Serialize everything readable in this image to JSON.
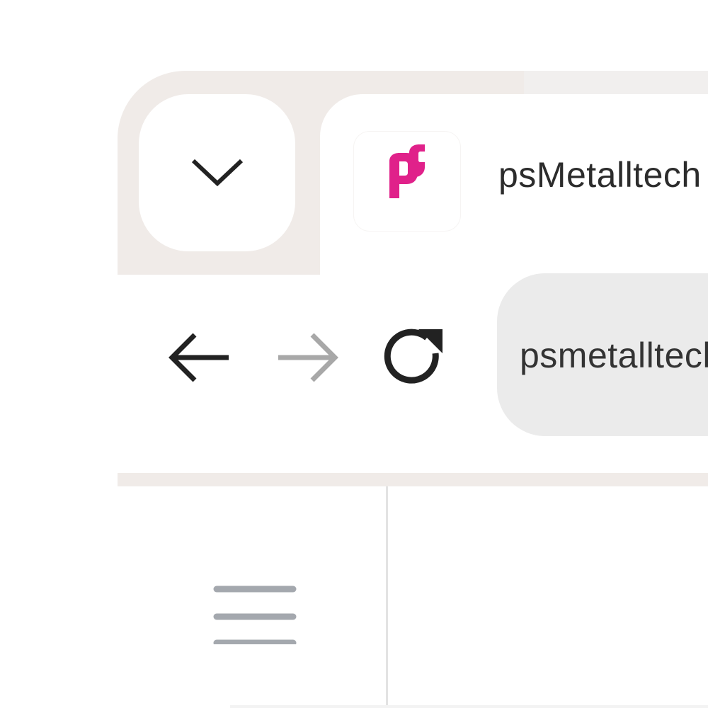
{
  "tab": {
    "title": "psMetalltech",
    "favicon": "ps-logo-icon",
    "favicon_color": "#e0218a"
  },
  "toolbar": {
    "back_icon": "arrow-left-icon",
    "forward_icon": "arrow-right-icon",
    "reload_icon": "reload-icon",
    "address": "psmetalltech"
  },
  "side_panel": {
    "menu_icon": "hamburger-menu-icon"
  },
  "colors": {
    "frame": "#f0ebe8",
    "omnibox": "#ebebeb",
    "icon_dark": "#222222",
    "icon_disabled": "#a8a8a8",
    "menu_icon": "#a4a8ae"
  }
}
